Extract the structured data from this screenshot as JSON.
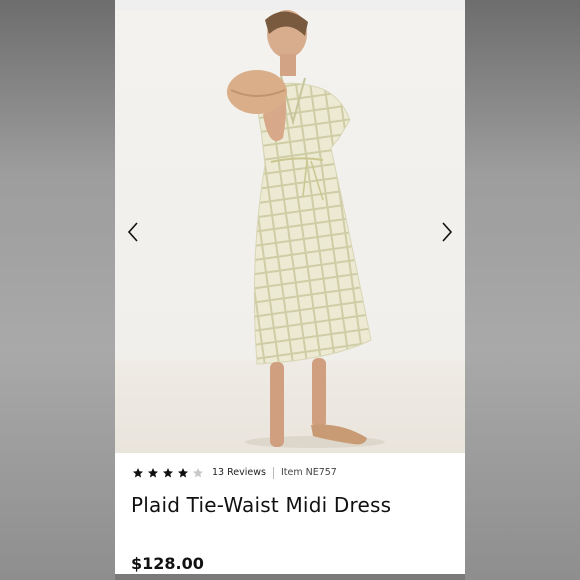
{
  "product": {
    "title": "Plaid Tie-Waist Midi Dress",
    "price": "$128.00",
    "rating": 4,
    "rating_max": 5,
    "reviews_label": "13 Reviews",
    "item_label": "Item NE757"
  },
  "carousel": {
    "prev_icon": "chevron-left-icon",
    "next_icon": "chevron-right-icon"
  },
  "colors": {
    "star_filled": "#111111",
    "star_empty": "#c8c8c8",
    "dress": "#ebe9cf",
    "plaid": "#c9c89d"
  }
}
